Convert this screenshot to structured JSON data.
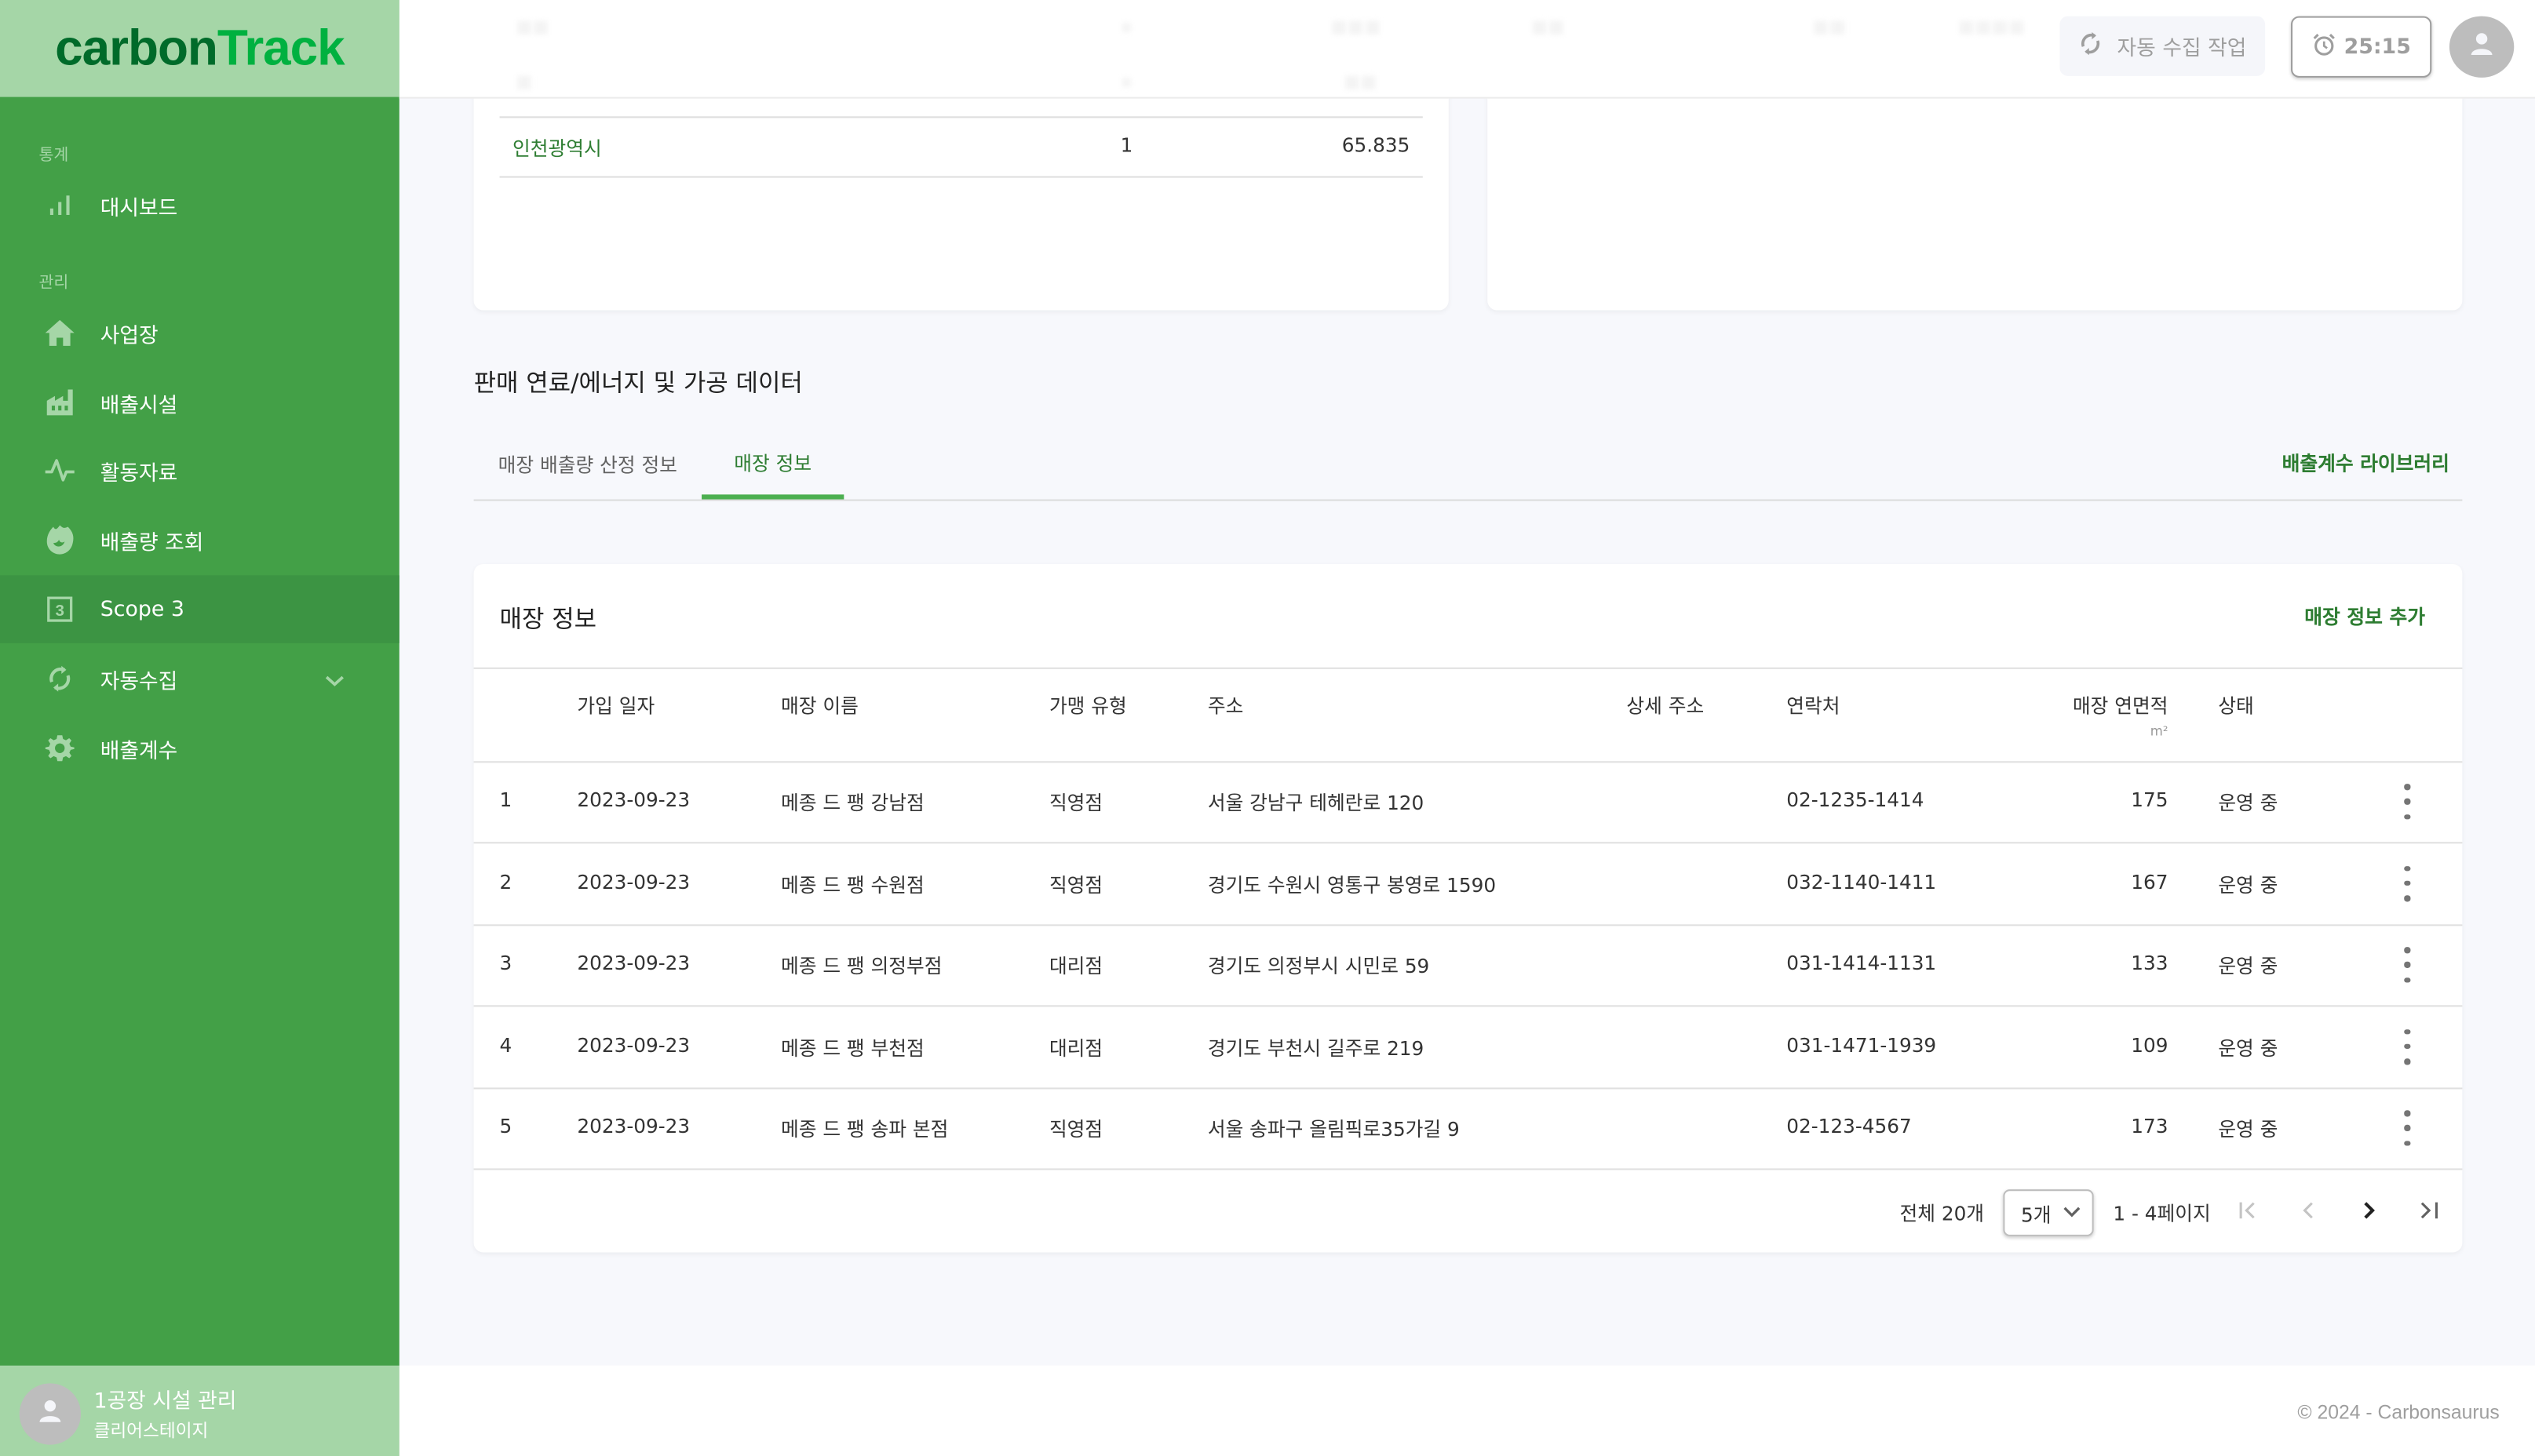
{
  "brand": {
    "part1": "carbon",
    "part2": "Track",
    "color_dark": "#006b2a",
    "color_light": "#00b140"
  },
  "colors": {
    "sidebar_bg": "#43a047",
    "sidebar_header_bg": "#a5d6a7",
    "accent": "#2e7d32",
    "tab_indicator": "#4caf50"
  },
  "sidebar": {
    "groups": [
      {
        "label": "통계"
      },
      {
        "label": "관리"
      }
    ],
    "items": [
      {
        "label": "대시보드",
        "icon": "bar-chart-icon"
      },
      {
        "label": "사업장",
        "icon": "home-icon"
      },
      {
        "label": "배출시설",
        "icon": "factory-icon"
      },
      {
        "label": "활동자료",
        "icon": "activity-icon"
      },
      {
        "label": "배출량 조회",
        "icon": "fire-icon"
      },
      {
        "label": "Scope 3",
        "icon": "scope3-icon",
        "active": true
      },
      {
        "label": "자동수집",
        "icon": "sync-icon",
        "expandable": true
      },
      {
        "label": "배출계수",
        "icon": "gear-icon"
      }
    ],
    "user": {
      "name": "1공장 시설 관리",
      "org": "클리어스테이지"
    }
  },
  "topbar": {
    "auto_collect_label": "자동 수집 작업",
    "timer": "25:15"
  },
  "region_table": {
    "rows": [
      {
        "name": "인천광역시",
        "count": "1",
        "value": "65.835"
      }
    ]
  },
  "section": {
    "title": "판매 연료/에너지 및 가공 데이터",
    "tabs": [
      {
        "label": "매장 배출량 산정 정보"
      },
      {
        "label": "매장 정보",
        "active": true
      }
    ],
    "library_link": "배출계수 라이브러리"
  },
  "store_table": {
    "title": "매장 정보",
    "add_label": "매장 정보 추가",
    "columns": [
      "가입 일자",
      "매장 이름",
      "가맹 유형",
      "주소",
      "상세 주소",
      "연락처",
      "매장 연면적",
      "상태"
    ],
    "area_unit": "m²",
    "rows": [
      {
        "no": "1",
        "date": "2023-09-23",
        "name": "메종 드 팽 강남점",
        "type": "직영점",
        "address": "서울 강남구 테헤란로 120",
        "detail": "",
        "phone": "02-1235-1414",
        "area": "175",
        "status": "운영 중"
      },
      {
        "no": "2",
        "date": "2023-09-23",
        "name": "메종 드 팽 수원점",
        "type": "직영점",
        "address": "경기도 수원시 영통구 봉영로 1590",
        "detail": "",
        "phone": "032-1140-1411",
        "area": "167",
        "status": "운영 중"
      },
      {
        "no": "3",
        "date": "2023-09-23",
        "name": "메종 드 팽 의정부점",
        "type": "대리점",
        "address": "경기도 의정부시 시민로 59",
        "detail": "",
        "phone": "031-1414-1131",
        "area": "133",
        "status": "운영 중"
      },
      {
        "no": "4",
        "date": "2023-09-23",
        "name": "메종 드 팽 부천점",
        "type": "대리점",
        "address": "경기도 부천시 길주로 219",
        "detail": "",
        "phone": "031-1471-1939",
        "area": "109",
        "status": "운영 중"
      },
      {
        "no": "5",
        "date": "2023-09-23",
        "name": "메종 드 팽 송파 본점",
        "type": "직영점",
        "address": "서울 송파구 올림픽로35가길 9",
        "detail": "",
        "phone": "02-123-4567",
        "area": "173",
        "status": "운영 중"
      }
    ],
    "pagination": {
      "total": "전체 20개",
      "page_size": "5개",
      "range": "1 - 4페이지"
    }
  },
  "footer": {
    "copyright": "© 2024 - Carbonsaurus"
  }
}
